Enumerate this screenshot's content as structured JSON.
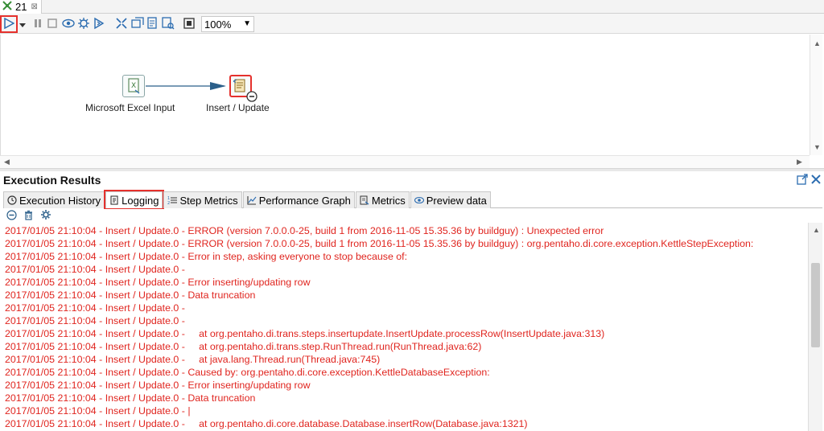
{
  "window": {
    "tab_title": "21",
    "tab_close_symbol": "⊠"
  },
  "toolbar": {
    "zoom_value": "100%",
    "buttons": [
      "run-icon",
      "run-options-icon",
      "pause-icon",
      "stop-icon",
      "preview-icon",
      "debug-icon",
      "replay-icon",
      "verify-icon",
      "impact-icon",
      "sql-icon",
      "explore-db-icon",
      "show-results-icon"
    ]
  },
  "canvas": {
    "steps": [
      {
        "label": "Microsoft Excel Input"
      },
      {
        "label": "Insert / Update"
      }
    ]
  },
  "results": {
    "title": "Execution Results",
    "tabs": [
      {
        "label": "Execution History"
      },
      {
        "label": "Logging"
      },
      {
        "label": "Step Metrics"
      },
      {
        "label": "Performance Graph"
      },
      {
        "label": "Metrics"
      },
      {
        "label": "Preview data"
      }
    ],
    "log_lines": [
      "2017/01/05 21:10:04 - Insert / Update.0 - ERROR (version 7.0.0.0-25, build 1 from 2016-11-05 15.35.36 by buildguy) : Unexpected error",
      "2017/01/05 21:10:04 - Insert / Update.0 - ERROR (version 7.0.0.0-25, build 1 from 2016-11-05 15.35.36 by buildguy) : org.pentaho.di.core.exception.KettleStepException:",
      "2017/01/05 21:10:04 - Insert / Update.0 - Error in step, asking everyone to stop because of:",
      "2017/01/05 21:10:04 - Insert / Update.0 -",
      "2017/01/05 21:10:04 - Insert / Update.0 - Error inserting/updating row",
      "2017/01/05 21:10:04 - Insert / Update.0 - Data truncation",
      "2017/01/05 21:10:04 - Insert / Update.0 -",
      "2017/01/05 21:10:04 - Insert / Update.0 -",
      "2017/01/05 21:10:04 - Insert / Update.0 -     at org.pentaho.di.trans.steps.insertupdate.InsertUpdate.processRow(InsertUpdate.java:313)",
      "2017/01/05 21:10:04 - Insert / Update.0 -     at org.pentaho.di.trans.step.RunThread.run(RunThread.java:62)",
      "2017/01/05 21:10:04 - Insert / Update.0 -     at java.lang.Thread.run(Thread.java:745)",
      "2017/01/05 21:10:04 - Insert / Update.0 - Caused by: org.pentaho.di.core.exception.KettleDatabaseException:",
      "2017/01/05 21:10:04 - Insert / Update.0 - Error inserting/updating row",
      "2017/01/05 21:10:04 - Insert / Update.0 - Data truncation",
      "2017/01/05 21:10:04 - Insert / Update.0 - |",
      "2017/01/05 21:10:04 - Insert / Update.0 -     at org.pentaho.di.core.database.Database.insertRow(Database.java:1321)"
    ]
  },
  "colors": {
    "log_error": "#e0251f",
    "highlight": "#e5312d",
    "accent_blue": "#2b6cb0"
  }
}
